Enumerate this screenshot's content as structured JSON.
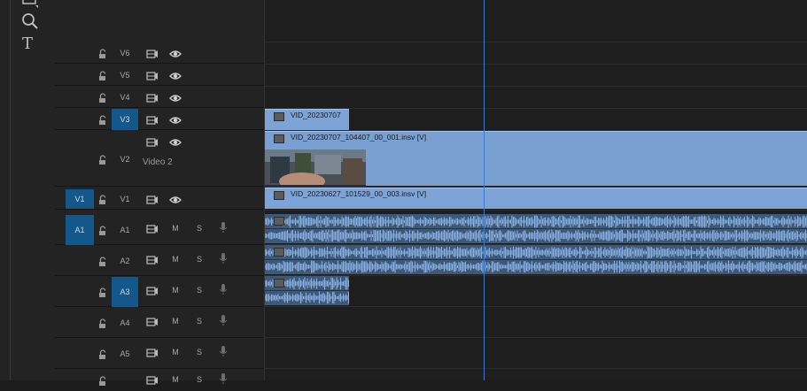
{
  "tools": [
    {
      "name": "rectangle-tool-icon"
    },
    {
      "name": "zoom-tool-icon"
    },
    {
      "name": "type-tool-icon",
      "glyph": "T"
    }
  ],
  "video_tracks": [
    {
      "id": "V6",
      "source_patch": "",
      "targeted": false
    },
    {
      "id": "V5",
      "source_patch": "",
      "targeted": false
    },
    {
      "id": "V4",
      "source_patch": "",
      "targeted": false
    },
    {
      "id": "V3",
      "source_patch": "",
      "targeted": true
    },
    {
      "id": "V2",
      "source_patch": "",
      "targeted": false,
      "track_label": "Video 2"
    },
    {
      "id": "V1",
      "source_patch": "V1",
      "targeted": false
    }
  ],
  "audio_tracks": [
    {
      "id": "A1",
      "source_patch": "A1",
      "targeted": false,
      "mute": "M",
      "solo": "S"
    },
    {
      "id": "A2",
      "source_patch": "",
      "targeted": false,
      "mute": "M",
      "solo": "S"
    },
    {
      "id": "A3",
      "source_patch": "",
      "targeted": true,
      "mute": "M",
      "solo": "S"
    },
    {
      "id": "A4",
      "source_patch": "",
      "targeted": false,
      "mute": "M",
      "solo": "S"
    },
    {
      "id": "A5",
      "source_patch": "",
      "targeted": false,
      "mute": "M",
      "solo": "S"
    }
  ],
  "clips": {
    "v3": "VID_20230707",
    "v2": "VID_20230707_104407_00_001.insv [V]",
    "v1": "VID_20230627_101529_00_003.insv [V]"
  },
  "colors": {
    "panel_bg": "#232323",
    "timeline_bg": "#1e1e1e",
    "target_blue": "#14578b",
    "video_clip": "#7ea3d6",
    "audio_clip": "#3e5877",
    "waveform": "#86aee0",
    "playhead": "#3b7ad2"
  }
}
